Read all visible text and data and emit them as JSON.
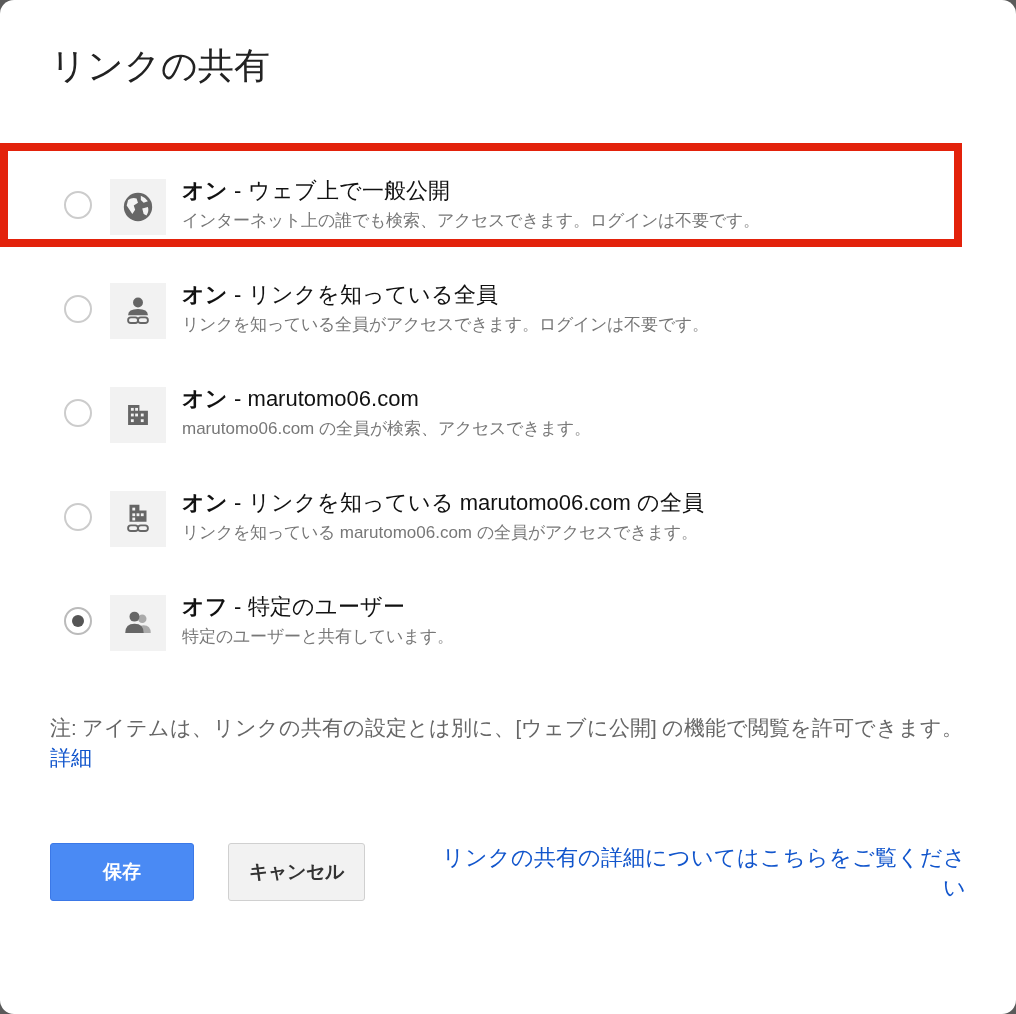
{
  "dialog": {
    "title": "リンクの共有"
  },
  "options": [
    {
      "kind": "globe",
      "title": "**オン** - ウェブ上で一般公開",
      "description": "インターネット上の誰でも検索、アクセスできます。ログインは不要です。",
      "selected": false,
      "highlighted": true
    },
    {
      "kind": "person-link",
      "title": "**オン** - リンクを知っている全員",
      "description": "リンクを知っている全員がアクセスできます。ログインは不要です。",
      "selected": false,
      "highlighted": false
    },
    {
      "kind": "building",
      "title": "**オン** - marutomo06.com",
      "description": "marutomo06.com の全員が検索、アクセスできます。",
      "selected": false,
      "highlighted": false
    },
    {
      "kind": "building-link",
      "title": "**オン** - リンクを知っている marutomo06.com の全員",
      "description": "リンクを知っている marutomo06.com の全員がアクセスできます。",
      "selected": false,
      "highlighted": false
    },
    {
      "kind": "people",
      "title": "**オフ** - 特定のユーザー",
      "description": "特定のユーザーと共有しています。",
      "selected": true,
      "highlighted": false
    }
  ],
  "note": {
    "text": "注: アイテムは、リンクの共有の設定とは別に、[ウェブに公開] の機能で閲覧を許可できます。",
    "link": "詳細"
  },
  "buttons": [
    {
      "kind": "primary",
      "label": "保存"
    },
    {
      "kind": "secondary",
      "label": "キャンセル"
    }
  ],
  "help_link": "リンクの共有の詳細についてはこちらをご覧ください"
}
